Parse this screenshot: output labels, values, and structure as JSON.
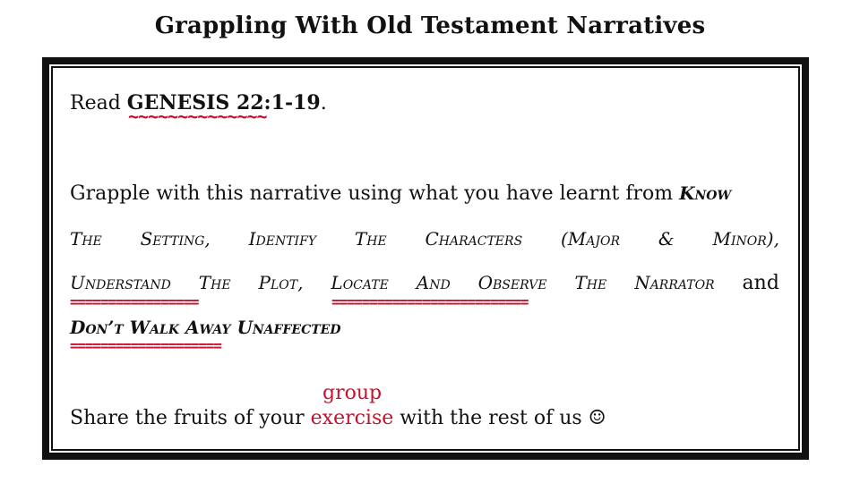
{
  "title": "Grappling With Old Testament Narratives",
  "read": {
    "prefix": "Read ",
    "reference": "GENESIS 22:1-19",
    "suffix": "."
  },
  "squiggle": "~~~~~~~~~~~~~~",
  "paragraph": {
    "intro": "Grapple with this narrative using what you have learnt from",
    "know": "Know",
    "setting_words": [
      "The",
      "Setting,",
      "Identify",
      "The",
      "Characters",
      "(Major",
      "&",
      "Minor),"
    ],
    "line4_words": [
      "Understand",
      "The",
      "Plot,",
      "Locate",
      "And",
      "Observe",
      "The",
      "Narrator"
    ],
    "and": "and",
    "dont_walk": "Don’t Walk Away Unaffected"
  },
  "underline_marks": {
    "first": "=================",
    "second": "==========================",
    "third": "===================="
  },
  "share": {
    "prefix": "Share the fruits of your",
    "exercise": "exercise",
    "suffix": "with the rest of us",
    "smiley": "☺",
    "group": "group"
  },
  "colors": {
    "accent_red": "#c8102e",
    "text": "#111111"
  }
}
